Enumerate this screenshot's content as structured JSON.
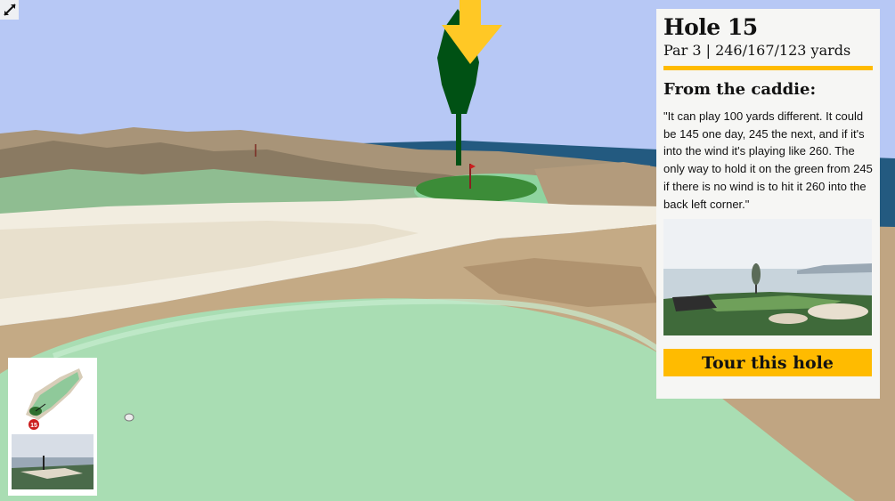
{
  "hole": {
    "title": "Hole 15",
    "meta": "Par 3 | 246/167/123 yards"
  },
  "caddie": {
    "heading": "From the caddie:",
    "quote": "\"It can play 100 yards different. It could be 145 one day, 245 the next, and if it's into the wind it's playing like 260. The only way to hold it on the green from 245 if there is no wind is to hit it 260 into the back left corner.\""
  },
  "tour_button": {
    "label": "Tour this hole"
  },
  "minimap": {
    "hole_number": "15"
  },
  "icons": {
    "expand": "expand-arrows-icon",
    "pin_marker": "arrow-down-marker-icon",
    "flag": "flag-icon"
  },
  "colors": {
    "accent": "#ffbb00",
    "sky": "#b7c8f5",
    "water": "#235a80",
    "green": "#a6ddb0",
    "pin_marker": "#005114",
    "panel_bg": "#f6f6f4"
  }
}
